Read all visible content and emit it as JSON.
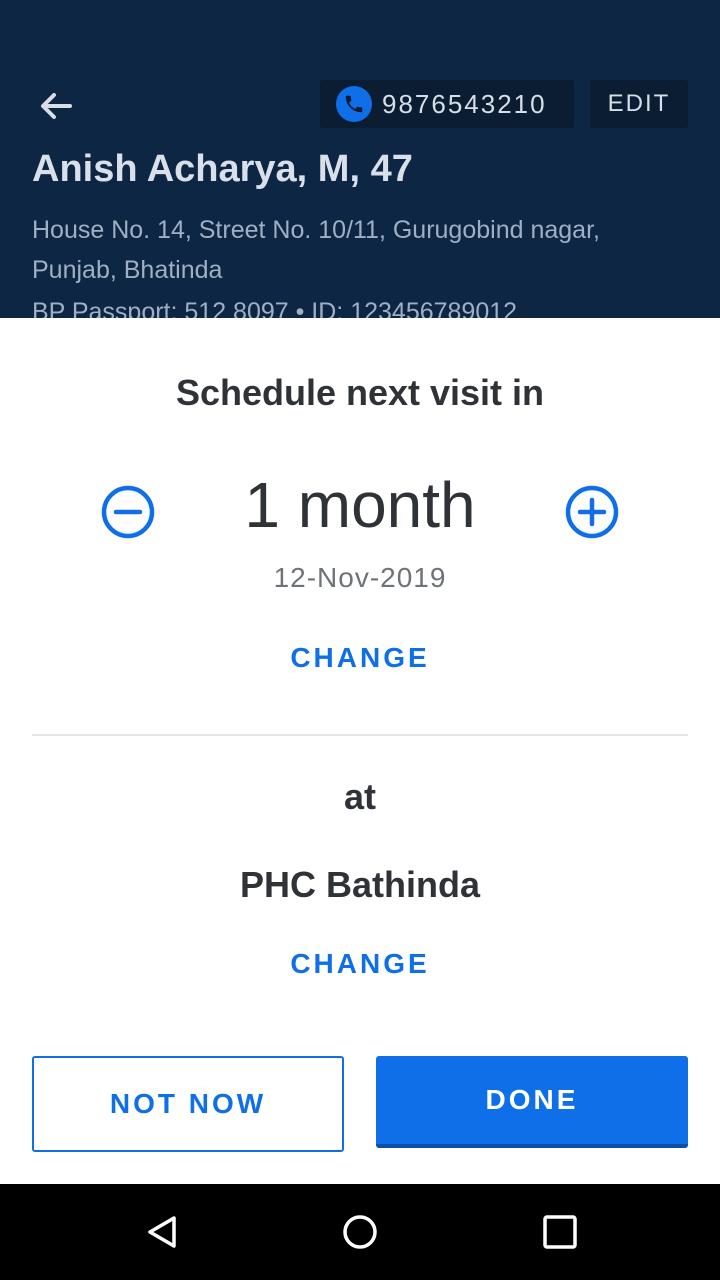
{
  "header": {
    "phone": "9876543210",
    "edit_label": "EDIT",
    "patient": "Anish Acharya, M, 47",
    "address": "House No. 14, Street No. 10/11, Gurugobind nagar, Punjab, Bhatinda",
    "id_line": "BP Passport: 512 8097  •  ID: 123456789012"
  },
  "sheet": {
    "title": "Schedule next visit in",
    "duration": "1 month",
    "date": "12-Nov-2019",
    "change_date_label": "CHANGE",
    "at_label": "at",
    "facility": "PHC Bathinda",
    "change_facility_label": "CHANGE",
    "not_now_label": "NOT NOW",
    "done_label": "DONE"
  },
  "colors": {
    "header_bg": "#0c2644",
    "accent": "#0f6fe8"
  },
  "icons": [
    "arrow-back-icon",
    "phone-icon",
    "minus-circle-icon",
    "plus-circle-icon",
    "nav-back-icon",
    "nav-home-icon",
    "nav-recents-icon"
  ]
}
